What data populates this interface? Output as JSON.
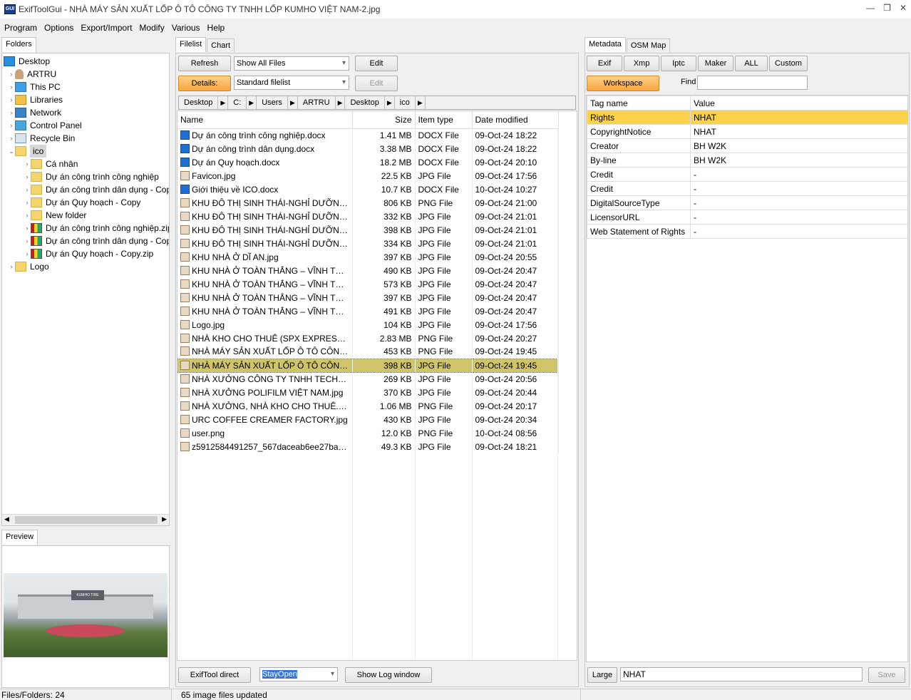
{
  "window": {
    "title": "ExifToolGui - NHÀ MÁY SẢN XUẤT LỐP Ô TÔ CÔNG TY TNHH LỐP KUMHO VIỆT NAM-2.jpg",
    "app_icon": "GUI"
  },
  "menu": [
    "Program",
    "Options",
    "Export/Import",
    "Modify",
    "Various",
    "Help"
  ],
  "folders": {
    "tab": "Folders",
    "items": [
      {
        "label": "Desktop",
        "level": 0,
        "icon": "desktop-icon"
      },
      {
        "label": "ARTRU",
        "level": 1,
        "icon": "user-icon"
      },
      {
        "label": "This PC",
        "level": 1,
        "icon": "computer-icon"
      },
      {
        "label": "Libraries",
        "level": 1,
        "icon": "libraries-icon"
      },
      {
        "label": "Network",
        "level": 1,
        "icon": "network-icon"
      },
      {
        "label": "Control Panel",
        "level": 1,
        "icon": "control-panel-icon"
      },
      {
        "label": "Recycle Bin",
        "level": 1,
        "icon": "recycle-bin-icon"
      },
      {
        "label": "ico",
        "level": 1,
        "icon": "folder-icon"
      },
      {
        "label": "Cá nhân",
        "level": 2,
        "icon": "folder-icon"
      },
      {
        "label": "Dự án công trình công nghiệp",
        "level": 2,
        "icon": "folder-icon"
      },
      {
        "label": "Dự án công trình dân dụng - Copy",
        "level": 2,
        "icon": "folder-icon"
      },
      {
        "label": "Dự án Quy hoạch - Copy",
        "level": 2,
        "icon": "folder-icon"
      },
      {
        "label": "New folder",
        "level": 2,
        "icon": "folder-icon"
      },
      {
        "label": "Dự án công trình công nghiệp.zip",
        "level": 2,
        "icon": "zip-icon"
      },
      {
        "label": "Dự án công trình dân dụng - Copy.zip",
        "level": 2,
        "icon": "zip-icon"
      },
      {
        "label": "Dự án Quy hoạch - Copy.zip",
        "level": 2,
        "icon": "zip-icon"
      },
      {
        "label": "Logo",
        "level": 1,
        "icon": "folder-icon"
      }
    ]
  },
  "preview": {
    "tab": "Preview",
    "sign_text": "KUMHO TIRE"
  },
  "filelist": {
    "tabs": [
      "Filelist",
      "Chart"
    ],
    "refresh": "Refresh",
    "show_combo": "Show All Files",
    "edit1": "Edit",
    "details": "Details:",
    "list_combo": "Standard filelist",
    "edit2": "Edit",
    "breadcrumb": [
      "Desktop",
      "C:",
      "Users",
      "ARTRU",
      "Desktop",
      "ico"
    ],
    "columns": [
      "Name",
      "Size",
      "Item type",
      "Date modified"
    ],
    "rows": [
      {
        "name": "Dự án công trình công nghiệp.docx",
        "size": "1.41 MB",
        "type": "DOCX File",
        "date": "09-Oct-24 18:22",
        "kind": "docx"
      },
      {
        "name": "Dự án công trình dân dụng.docx",
        "size": "3.38 MB",
        "type": "DOCX File",
        "date": "09-Oct-24 18:22",
        "kind": "docx"
      },
      {
        "name": "Dự án Quy hoạch.docx",
        "size": "18.2 MB",
        "type": "DOCX File",
        "date": "09-Oct-24 20:10",
        "kind": "docx"
      },
      {
        "name": "Favicon.jpg",
        "size": "22.5 KB",
        "type": "JPG File",
        "date": "09-Oct-24 17:56",
        "kind": "img"
      },
      {
        "name": "Giới thiệu về ICO.docx",
        "size": "10.7 KB",
        "type": "DOCX File",
        "date": "10-Oct-24 10:27",
        "kind": "docx"
      },
      {
        "name": "KHU ĐÔ THỊ SINH THÁI-NGHỈ DƯỠNG,...",
        "size": "806 KB",
        "type": "PNG File",
        "date": "09-Oct-24 21:00",
        "kind": "img"
      },
      {
        "name": "KHU ĐÔ THỊ SINH THÁI-NGHỈ DƯỠNG,...",
        "size": "332 KB",
        "type": "JPG File",
        "date": "09-Oct-24 21:01",
        "kind": "img"
      },
      {
        "name": "KHU ĐÔ THỊ SINH THÁI-NGHỈ DƯỠNG,...",
        "size": "398 KB",
        "type": "JPG File",
        "date": "09-Oct-24 21:01",
        "kind": "img"
      },
      {
        "name": "KHU ĐÔ THỊ SINH THÁI-NGHỈ DƯỠNG,...",
        "size": "334 KB",
        "type": "JPG File",
        "date": "09-Oct-24 21:01",
        "kind": "img"
      },
      {
        "name": "KHU NHÀ Ở DĨ AN.jpg",
        "size": "397 KB",
        "type": "JPG File",
        "date": "09-Oct-24 20:55",
        "kind": "img"
      },
      {
        "name": "KHU NHÀ Ở TOÀN THẮNG – VĨNH TÂN...",
        "size": "490 KB",
        "type": "JPG File",
        "date": "09-Oct-24 20:47",
        "kind": "img"
      },
      {
        "name": "KHU NHÀ Ở TOÀN THẮNG – VĨNH TÂN...",
        "size": "573 KB",
        "type": "JPG File",
        "date": "09-Oct-24 20:47",
        "kind": "img"
      },
      {
        "name": "KHU NHÀ Ở TOÀN THẮNG – VĨNH TÂN...",
        "size": "397 KB",
        "type": "JPG File",
        "date": "09-Oct-24 20:47",
        "kind": "img"
      },
      {
        "name": "KHU NHÀ Ở TOÀN THẮNG – VĨNH TÂN...",
        "size": "491 KB",
        "type": "JPG File",
        "date": "09-Oct-24 20:47",
        "kind": "img"
      },
      {
        "name": "Logo.jpg",
        "size": "104 KB",
        "type": "JPG File",
        "date": "09-Oct-24 17:56",
        "kind": "img"
      },
      {
        "name": "NHÀ KHO CHO THUÊ (SPX EXPRESS).png",
        "size": "2.83 MB",
        "type": "PNG File",
        "date": "09-Oct-24 20:27",
        "kind": "img"
      },
      {
        "name": "NHÀ MÁY SẢN XUẤT LỐP Ô TÔ CÔNG ...",
        "size": "453 KB",
        "type": "PNG File",
        "date": "09-Oct-24 19:45",
        "kind": "img"
      },
      {
        "name": "NHÀ MÁY SẢN XUẤT LỐP Ô TÔ CÔNG ...",
        "size": "398 KB",
        "type": "JPG File",
        "date": "09-Oct-24 19:45",
        "kind": "img",
        "selected": true
      },
      {
        "name": "NHÀ XƯỞNG CÔNG TY TNHH TECHN...",
        "size": "269 KB",
        "type": "JPG File",
        "date": "09-Oct-24 20:56",
        "kind": "img"
      },
      {
        "name": "NHÀ XƯỞNG POLIFILM VIỆT NAM.jpg",
        "size": "370 KB",
        "type": "JPG File",
        "date": "09-Oct-24 20:44",
        "kind": "img"
      },
      {
        "name": "NHÀ XƯỞNG, NHÀ KHO CHO THUÊ.png",
        "size": "1.06 MB",
        "type": "PNG File",
        "date": "09-Oct-24 20:17",
        "kind": "img"
      },
      {
        "name": "URC COFFEE CREAMER FACTORY.jpg",
        "size": "430 KB",
        "type": "JPG File",
        "date": "09-Oct-24 20:34",
        "kind": "img"
      },
      {
        "name": "user.png",
        "size": "12.0 KB",
        "type": "PNG File",
        "date": "10-Oct-24 08:56",
        "kind": "img"
      },
      {
        "name": "z5912584491257_567daceab6ee27badba...",
        "size": "49.3 KB",
        "type": "JPG File",
        "date": "09-Oct-24 18:21",
        "kind": "img"
      }
    ],
    "exiftool_direct": "ExifTool direct",
    "stayopen": "StayOpen",
    "showlog": "Show Log window"
  },
  "metadata": {
    "tabs": [
      "Metadata",
      "OSM Map"
    ],
    "buttons": [
      "Exif",
      "Xmp",
      "Iptc",
      "Maker",
      "ALL",
      "Custom"
    ],
    "workspace": "Workspace",
    "find_label": "Find",
    "columns": [
      "Tag name",
      "Value"
    ],
    "rows": [
      {
        "tag": "Rights",
        "value": "NHAT",
        "hl": true
      },
      {
        "tag": "CopyrightNotice",
        "value": "NHAT"
      },
      {
        "tag": "Creator",
        "value": "BH W2K"
      },
      {
        "tag": "By-line",
        "value": "BH W2K"
      },
      {
        "tag": "Credit",
        "value": "-"
      },
      {
        "tag": "Credit",
        "value": "-"
      },
      {
        "tag": "DigitalSourceType",
        "value": "-"
      },
      {
        "tag": "LicensorURL",
        "value": "-"
      },
      {
        "tag": "Web Statement of Rights",
        "value": "-"
      }
    ],
    "large": "Large",
    "edit_value": "NHAT",
    "save": "Save"
  },
  "status": {
    "left": "Files/Folders: 24",
    "mid": "65 image files updated"
  }
}
